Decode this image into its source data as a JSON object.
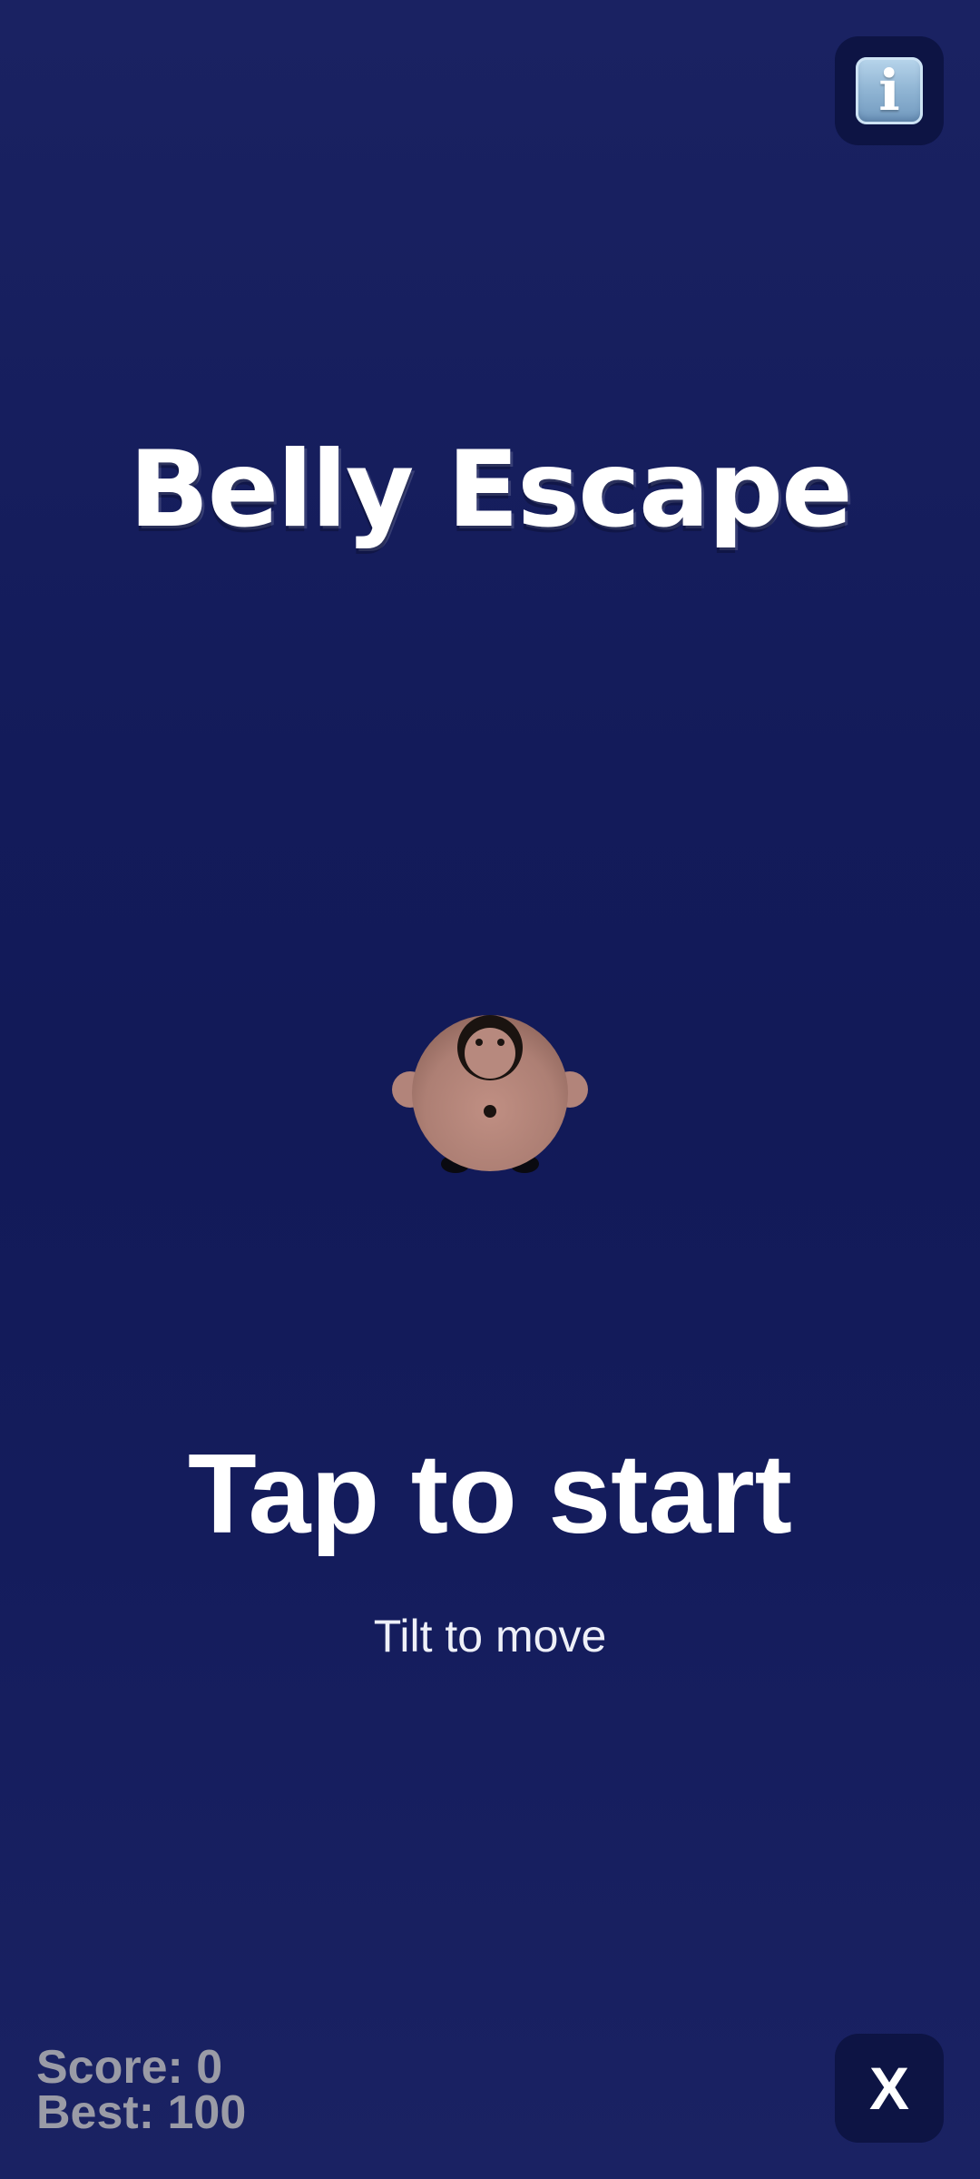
{
  "game": {
    "title": "Belly Escape",
    "start_prompt": "Tap to start",
    "instruction": "Tilt to move"
  },
  "info_button": {
    "icon": "info-icon",
    "glyph": "i"
  },
  "stats": {
    "score_label": "Score: 0",
    "best_label": "Best: 100"
  },
  "close_button": {
    "label": "X"
  },
  "colors": {
    "background": "#151d5d",
    "button_background": "#0d1444",
    "text": "#ffffff",
    "score_text": "#9a9ba6",
    "character_skin": "#b88a7e",
    "character_hair": "#1a1310"
  }
}
